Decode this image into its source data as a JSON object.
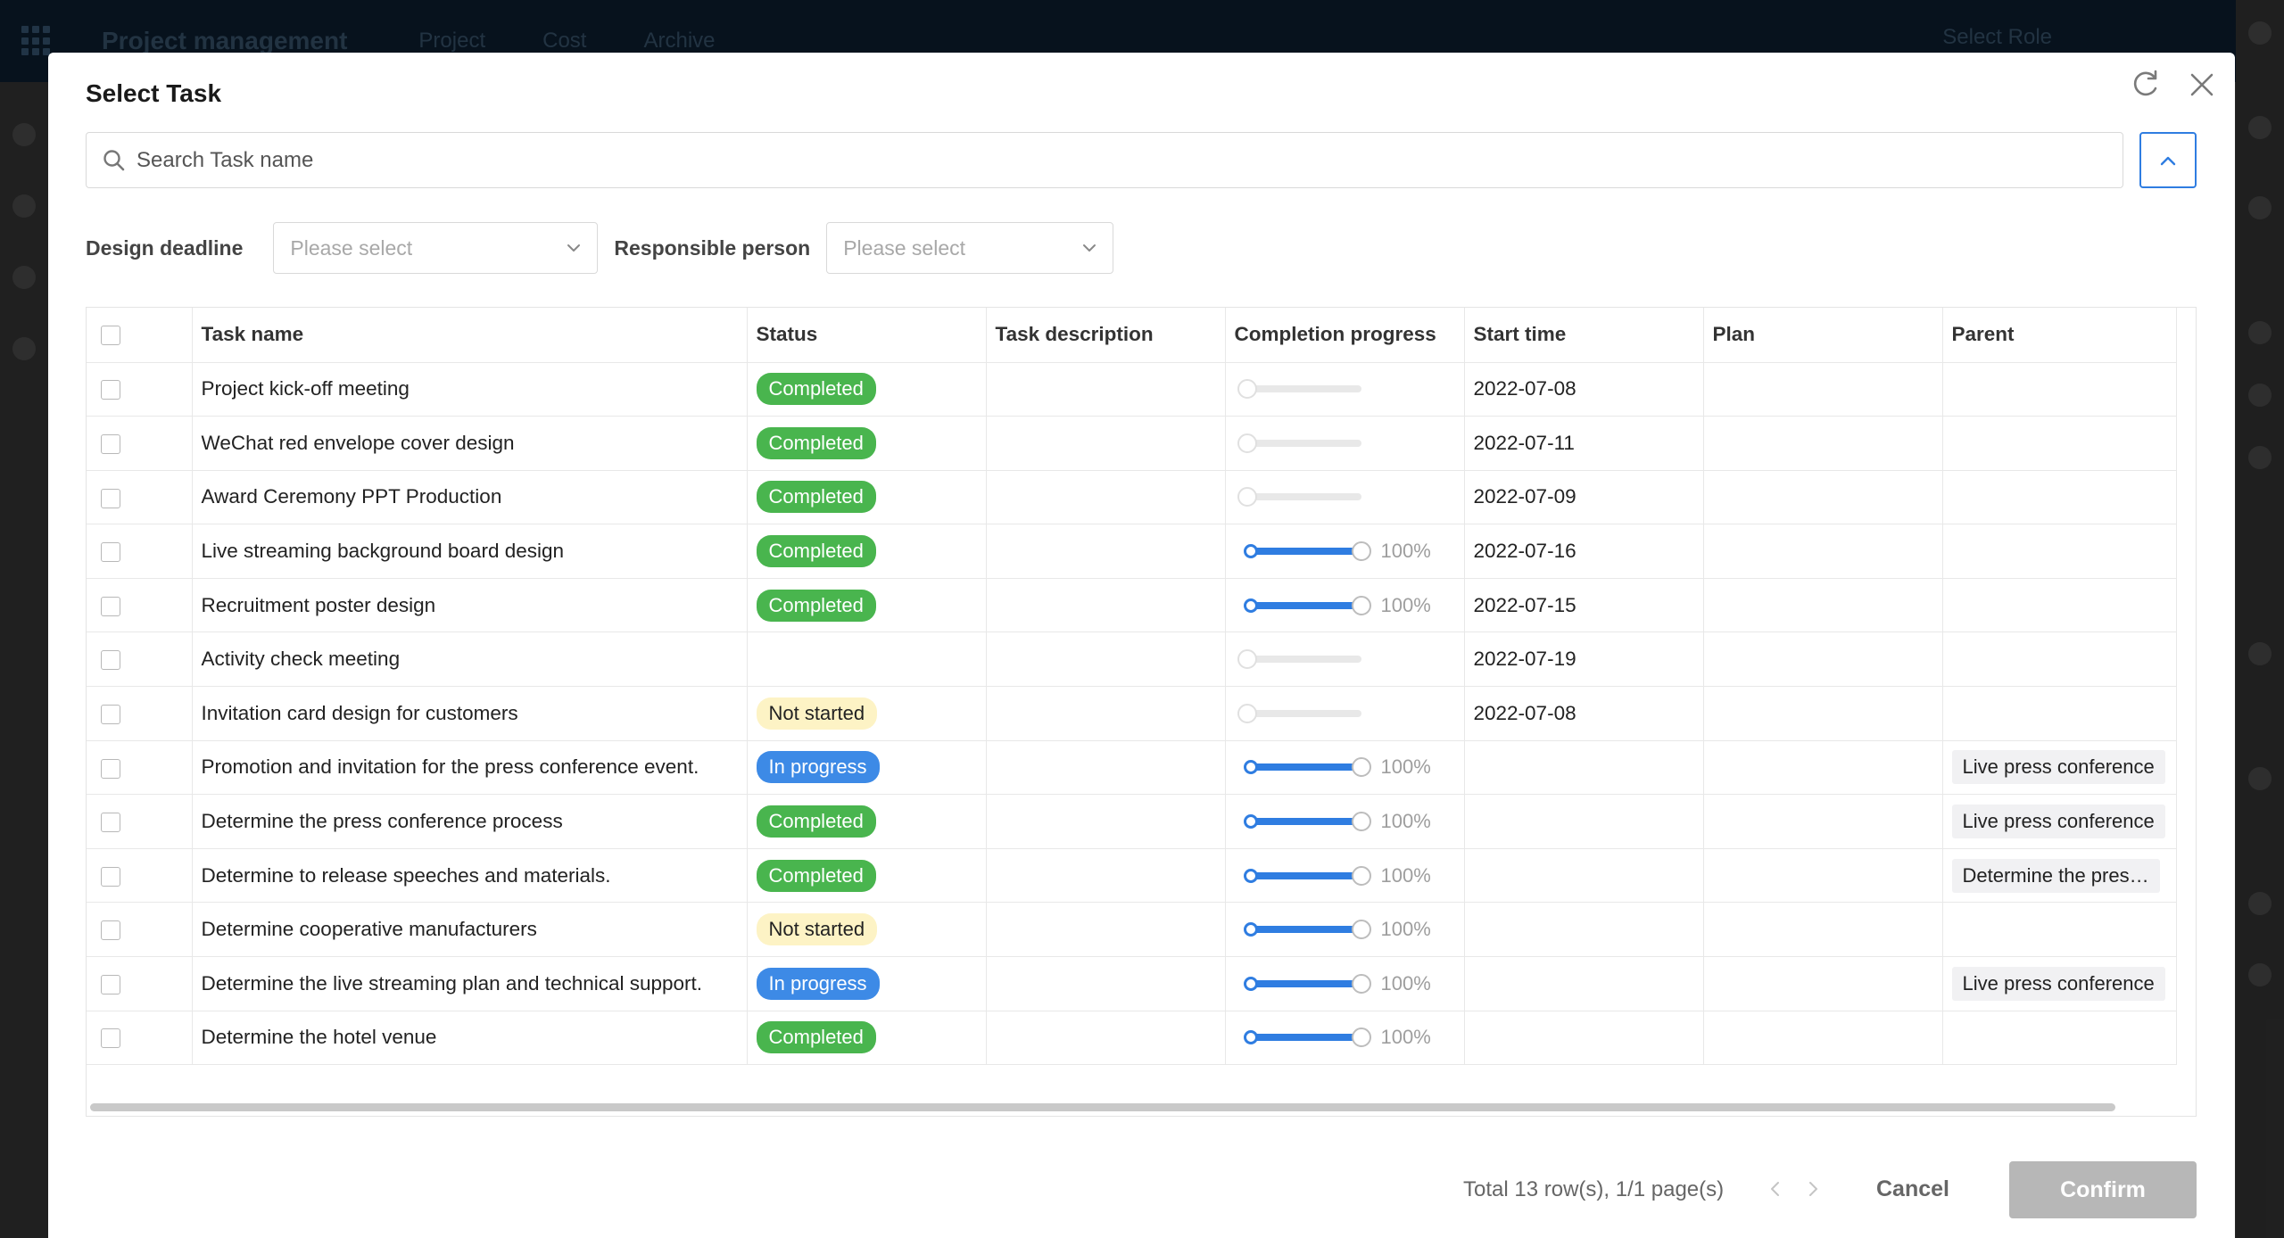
{
  "background_app": {
    "title": "Project management",
    "nav": [
      "Project",
      "Cost",
      "Archive"
    ],
    "role": "Select Role"
  },
  "modal": {
    "title": "Select Task"
  },
  "search": {
    "placeholder": "Search Task name",
    "value": ""
  },
  "filters": {
    "design_deadline_label": "Design deadline",
    "design_deadline_placeholder": "Please select",
    "responsible_person_label": "Responsible person",
    "responsible_person_placeholder": "Please select"
  },
  "table": {
    "headers": [
      "Task name",
      "Status",
      "Task description",
      "Completion progress",
      "Start time",
      "Plan",
      "Parent"
    ],
    "rows": [
      {
        "name": "Project kick-off meeting",
        "status": "Completed",
        "status_type": "done",
        "description": "",
        "progress": 0,
        "progress_label": "",
        "start": "2022-07-08",
        "plan": "",
        "parent": ""
      },
      {
        "name": "WeChat red envelope cover design",
        "status": "Completed",
        "status_type": "done",
        "description": "",
        "progress": 0,
        "progress_label": "",
        "start": "2022-07-11",
        "plan": "",
        "parent": ""
      },
      {
        "name": "Award Ceremony PPT Production",
        "status": "Completed",
        "status_type": "done",
        "description": "",
        "progress": 0,
        "progress_label": "",
        "start": "2022-07-09",
        "plan": "",
        "parent": ""
      },
      {
        "name": "Live streaming background board design",
        "status": "Completed",
        "status_type": "done",
        "description": "",
        "progress": 100,
        "progress_label": "100%",
        "start": "2022-07-16",
        "plan": "",
        "parent": ""
      },
      {
        "name": "Recruitment poster design",
        "status": "Completed",
        "status_type": "done",
        "description": "",
        "progress": 100,
        "progress_label": "100%",
        "start": "2022-07-15",
        "plan": "",
        "parent": ""
      },
      {
        "name": "Activity check meeting",
        "status": "",
        "status_type": "none",
        "description": "",
        "progress": 0,
        "progress_label": "",
        "start": "2022-07-19",
        "plan": "",
        "parent": ""
      },
      {
        "name": "Invitation card design for customers",
        "status": "Not started",
        "status_type": "ns",
        "description": "",
        "progress": 0,
        "progress_label": "",
        "start": "2022-07-08",
        "plan": "",
        "parent": ""
      },
      {
        "name": "Promotion and invitation for the press conference event.",
        "status": "In progress",
        "status_type": "ip",
        "description": "",
        "progress": 100,
        "progress_label": "100%",
        "start": "",
        "plan": "",
        "parent": "Live press conference"
      },
      {
        "name": "Determine the press conference process",
        "status": "Completed",
        "status_type": "done",
        "description": "",
        "progress": 100,
        "progress_label": "100%",
        "start": "",
        "plan": "",
        "parent": "Live press conference"
      },
      {
        "name": "Determine to release speeches and materials.",
        "status": "Completed",
        "status_type": "done",
        "description": "",
        "progress": 100,
        "progress_label": "100%",
        "start": "",
        "plan": "",
        "parent": "Determine the pres…"
      },
      {
        "name": "Determine cooperative manufacturers",
        "status": "Not started",
        "status_type": "ns",
        "description": "",
        "progress": 100,
        "progress_label": "100%",
        "start": "",
        "plan": "",
        "parent": ""
      },
      {
        "name": "Determine the live streaming plan and technical support.",
        "status": "In progress",
        "status_type": "ip",
        "description": "",
        "progress": 100,
        "progress_label": "100%",
        "start": "",
        "plan": "",
        "parent": "Live press conference"
      },
      {
        "name": "Determine the hotel venue",
        "status": "Completed",
        "status_type": "done",
        "description": "",
        "progress": 100,
        "progress_label": "100%",
        "start": "",
        "plan": "",
        "parent": ""
      }
    ]
  },
  "footer": {
    "total": "Total 13 row(s), 1/1 page(s)",
    "cancel_label": "Cancel",
    "confirm_label": "Confirm"
  },
  "colors": {
    "completed": "#49b54e",
    "not_started": "#fdf3c5",
    "in_progress": "#3d8ae6",
    "accent": "#2f7de1"
  }
}
